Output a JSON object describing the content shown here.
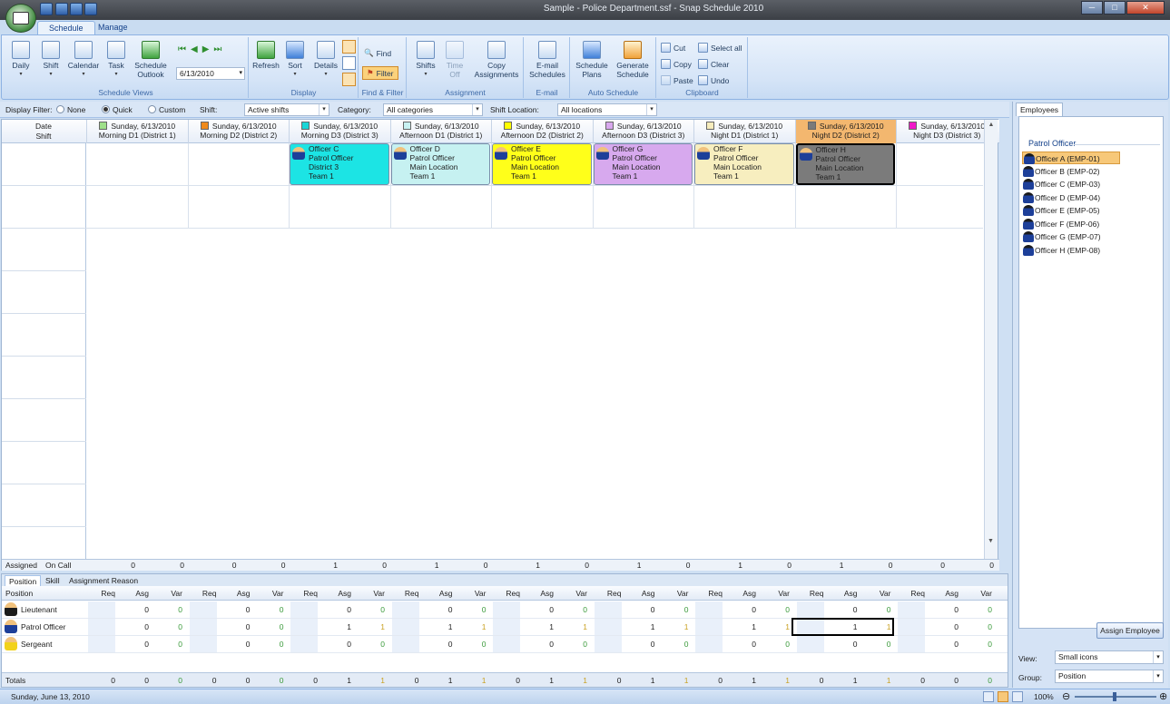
{
  "window": {
    "title": "Sample - Police Department.ssf - Snap Schedule 2010",
    "controls": [
      "─",
      "□",
      "✕"
    ]
  },
  "ribbon": {
    "tabs": [
      "Schedule",
      "Manage"
    ],
    "groups": {
      "views": {
        "label": "Schedule Views",
        "daily": "Daily",
        "shift": "Shift",
        "calendar": "Calendar",
        "task": "Task",
        "outlook": "Schedule Outlook",
        "date": "6/13/2010"
      },
      "display": {
        "label": "Display",
        "refresh": "Refresh",
        "sort": "Sort",
        "details": "Details"
      },
      "find": {
        "label": "Find & Filter",
        "find": "Find",
        "filter": "Filter"
      },
      "assignment": {
        "label": "Assignment",
        "shifts": "Shifts",
        "timeoff": "Time Off",
        "copy": "Copy Assignments"
      },
      "email": {
        "label": "E-mail",
        "email": "E-mail Schedules"
      },
      "auto": {
        "label": "Auto Schedule",
        "plans": "Schedule Plans",
        "generate": "Generate Schedule"
      },
      "clipboard": {
        "label": "Clipboard",
        "cut": "Cut",
        "copy": "Copy",
        "paste": "Paste",
        "select_all": "Select all",
        "clear": "Clear",
        "undo": "Undo"
      }
    }
  },
  "filterbar": {
    "display_filter": "Display Filter:",
    "none": "None",
    "quick": "Quick",
    "custom": "Custom",
    "shift_label": "Shift:",
    "shift_value": "Active shifts",
    "category_label": "Category:",
    "category_value": "All categories",
    "location_label": "Shift Location:",
    "location_value": "All locations"
  },
  "grid": {
    "corner": {
      "line1": "Date",
      "line2": "Shift"
    },
    "columns": [
      {
        "date": "Sunday, 6/13/2010",
        "shift": "Morning D1 (District 1)",
        "color": "#9fe08a"
      },
      {
        "date": "Sunday, 6/13/2010",
        "shift": "Morning D2 (District 2)",
        "color": "#f08a1a"
      },
      {
        "date": "Sunday, 6/13/2010",
        "shift": "Morning D3 (District 3)",
        "color": "#1ad6d6"
      },
      {
        "date": "Sunday, 6/13/2010",
        "shift": "Afternoon D1 (District 1)",
        "color": "#c8f2f2"
      },
      {
        "date": "Sunday, 6/13/2010",
        "shift": "Afternoon D2 (District 2)",
        "color": "#ffff00"
      },
      {
        "date": "Sunday, 6/13/2010",
        "shift": "Afternoon D3 (District 3)",
        "color": "#d8a8ee"
      },
      {
        "date": "Sunday, 6/13/2010",
        "shift": "Night D1 (District 1)",
        "color": "#f6ecbc"
      },
      {
        "date": "Sunday, 6/13/2010",
        "shift": "Night D2 (District 2)",
        "color": "#7a7a7a"
      },
      {
        "date": "Sunday, 6/13/2010",
        "shift": "Night D3 (District 3)",
        "color": "#f018c8"
      }
    ],
    "cards": [
      {
        "col": 2,
        "name": "Officer C",
        "pos": "Patrol Officer",
        "loc": "District 3",
        "team": "Team 1",
        "color": "#1ce4e4"
      },
      {
        "col": 3,
        "name": "Officer D",
        "pos": "Patrol Officer",
        "loc": "Main Location",
        "team": "Team 1",
        "color": "#c6f1f1"
      },
      {
        "col": 4,
        "name": "Officer E",
        "pos": "Patrol Officer",
        "loc": "Main Location",
        "team": "Team 1",
        "color": "#ffff1a"
      },
      {
        "col": 5,
        "name": "Officer G",
        "pos": "Patrol Officer",
        "loc": "Main Location",
        "team": "Team 1",
        "color": "#d7a9ee"
      },
      {
        "col": 6,
        "name": "Officer F",
        "pos": "Patrol Officer",
        "loc": "Main Location",
        "team": "Team 1",
        "color": "#f7eebf"
      },
      {
        "col": 7,
        "name": "Officer H",
        "pos": "Patrol Officer",
        "loc": "Main Location",
        "team": "Team 1",
        "color": "#7b7b7b"
      }
    ],
    "assigned_label": "Assigned",
    "oncall_label": "On Call",
    "assigned": [
      [
        "0",
        "0"
      ],
      [
        "0",
        "0"
      ],
      [
        "1",
        "0"
      ],
      [
        "1",
        "0"
      ],
      [
        "1",
        "0"
      ],
      [
        "1",
        "0"
      ],
      [
        "1",
        "0"
      ],
      [
        "1",
        "0"
      ],
      [
        "0",
        "0"
      ]
    ]
  },
  "lower": {
    "tabs": [
      "Position",
      "Skill",
      "Assignment Reason"
    ],
    "position_header": "Position",
    "subheads": [
      "Req",
      "Asg",
      "Var"
    ],
    "rows": [
      {
        "name": "Lieutenant",
        "avatar": "#1b1b1b",
        "asg": [
          "0",
          "0",
          "0",
          "0",
          "0",
          "0",
          "0",
          "0",
          "0"
        ],
        "var": [
          "0",
          "0",
          "0",
          "0",
          "0",
          "0",
          "0",
          "0",
          "0"
        ]
      },
      {
        "name": "Patrol Officer",
        "avatar": "#1d3f99",
        "asg": [
          "0",
          "0",
          "1",
          "1",
          "1",
          "1",
          "1",
          "1",
          "0"
        ],
        "var": [
          "0",
          "0",
          "1",
          "1",
          "1",
          "1",
          "1",
          "1",
          "0"
        ]
      },
      {
        "name": "Sergeant",
        "avatar": "#f2d21a",
        "asg": [
          "0",
          "0",
          "0",
          "0",
          "0",
          "0",
          "0",
          "0",
          "0"
        ],
        "var": [
          "0",
          "0",
          "0",
          "0",
          "0",
          "0",
          "0",
          "0",
          "0"
        ]
      }
    ],
    "totals_label": "Totals",
    "totals": [
      [
        "0",
        "0",
        "0"
      ],
      [
        "0",
        "0",
        "0"
      ],
      [
        "0",
        "1",
        "1"
      ],
      [
        "0",
        "1",
        "1"
      ],
      [
        "0",
        "1",
        "1"
      ],
      [
        "0",
        "1",
        "1"
      ],
      [
        "0",
        "1",
        "1"
      ],
      [
        "0",
        "1",
        "1"
      ],
      [
        "0",
        "0",
        "0"
      ]
    ]
  },
  "right": {
    "tab": "Employees",
    "group": "Patrol Officer",
    "employees": [
      "Officer A (EMP-01)",
      "Officer B (EMP-02)",
      "Officer C (EMP-03)",
      "Officer D (EMP-04)",
      "Officer E (EMP-05)",
      "Officer F (EMP-06)",
      "Officer G (EMP-07)",
      "Officer H (EMP-08)"
    ],
    "assign_button": "Assign Employee",
    "view_label": "View:",
    "view_value": "Small icons",
    "group_label": "Group:",
    "group_value": "Position"
  },
  "status": {
    "date": "Sunday, June 13, 2010",
    "zoom": "100%"
  }
}
